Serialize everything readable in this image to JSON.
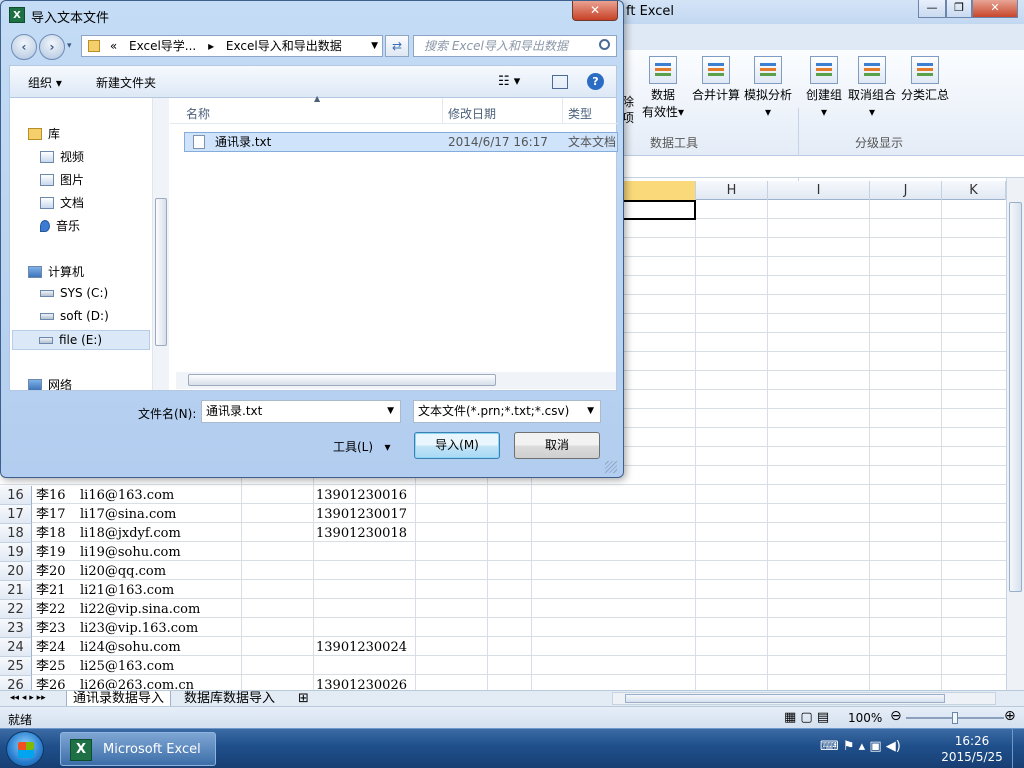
{
  "excel": {
    "title": "ft Excel",
    "ribbon": {
      "buttons": [
        "数据",
        "有效性",
        "合并计算",
        "模拟分析",
        "创建组",
        "取消组合",
        "分类汇总"
      ],
      "partial": [
        "除",
        "项"
      ],
      "groups": {
        "data_tools": "数据工具",
        "outline": "分级显示"
      }
    },
    "columns": [
      "H",
      "I",
      "J",
      "K"
    ],
    "rows": [
      {
        "n": "16",
        "name": "李16",
        "email": "li16@163.com",
        "phone": "13901230016"
      },
      {
        "n": "17",
        "name": "李17",
        "email": "li17@sina.com",
        "phone": "13901230017"
      },
      {
        "n": "18",
        "name": "李18",
        "email": "li18@jxdyf.com",
        "phone": "13901230018"
      },
      {
        "n": "19",
        "name": "李19",
        "email": "li19@sohu.com",
        "phone": ""
      },
      {
        "n": "20",
        "name": "李20",
        "email": "li20@qq.com",
        "phone": ""
      },
      {
        "n": "21",
        "name": "李21",
        "email": "li21@163.com",
        "phone": ""
      },
      {
        "n": "22",
        "name": "李22",
        "email": "li22@vip.sina.com",
        "phone": ""
      },
      {
        "n": "23",
        "name": "李23",
        "email": "li23@vip.163.com",
        "phone": ""
      },
      {
        "n": "24",
        "name": "李24",
        "email": "li24@sohu.com",
        "phone": "13901230024"
      },
      {
        "n": "25",
        "name": "李25",
        "email": "li25@163.com",
        "phone": ""
      },
      {
        "n": "26",
        "name": "李26",
        "email": "li26@263.com.cn",
        "phone": "13901230026"
      }
    ],
    "sheets": [
      "通讯录数据导入",
      "数据库数据导入"
    ],
    "status": "就绪",
    "zoom": "100%",
    "zoom_level": 1.0
  },
  "dialog": {
    "title": "导入文本文件",
    "address": [
      "«",
      "Excel导学...",
      "▸",
      "Excel导入和导出数据"
    ],
    "search_placeholder": "搜索 Excel导入和导出数据",
    "toolbar": {
      "organize": "组织 ▾",
      "new_folder": "新建文件夹"
    },
    "nav": [
      {
        "label": "库",
        "icon": "library-icon"
      },
      {
        "label": "视频",
        "icon": "video-icon"
      },
      {
        "label": "图片",
        "icon": "pictures-icon"
      },
      {
        "label": "文档",
        "icon": "documents-icon"
      },
      {
        "label": "音乐",
        "icon": "music-icon"
      },
      {
        "label": "计算机",
        "icon": "computer-icon"
      },
      {
        "label": "SYS (C:)",
        "icon": "drive-icon"
      },
      {
        "label": "soft (D:)",
        "icon": "drive-icon"
      },
      {
        "label": "file (E:)",
        "icon": "drive-icon"
      },
      {
        "label": "网络",
        "icon": "network-icon"
      }
    ],
    "columns": {
      "name": "名称",
      "date": "修改日期",
      "type": "类型"
    },
    "files": [
      {
        "name": "通讯录.txt",
        "date": "2014/6/17 16:17",
        "type": "文本文档"
      }
    ],
    "filename_label": "文件名(N):",
    "filename_value": "通讯录.txt",
    "filetype_value": "文本文件(*.prn;*.txt;*.csv)",
    "tools": "工具(L)",
    "import": "导入(M)",
    "cancel": "取消"
  },
  "taskbar": {
    "task": "Microsoft Excel ...",
    "time": "16:26",
    "date": "2015/5/25"
  }
}
